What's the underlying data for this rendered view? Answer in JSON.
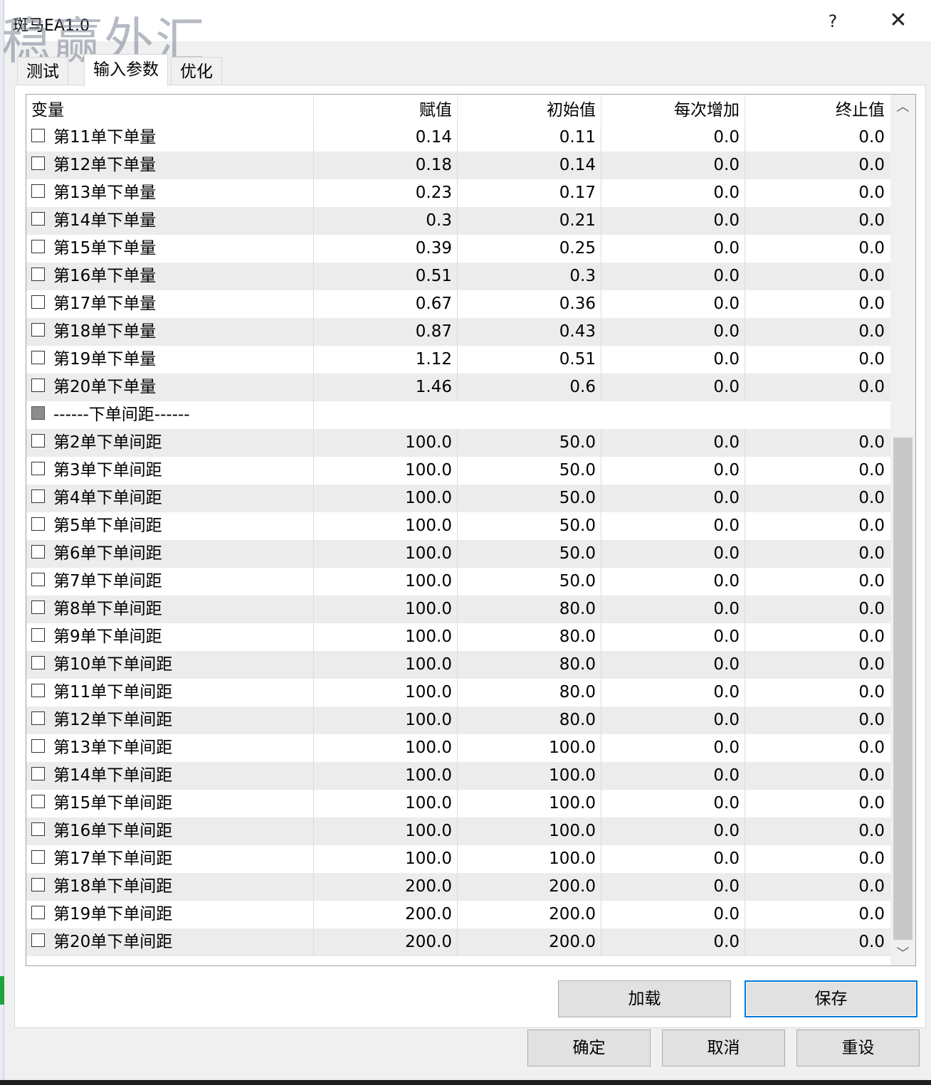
{
  "window": {
    "title": "斑马EA1.0",
    "watermark": "稳赢外汇",
    "help_label": "?",
    "close_label": "✕"
  },
  "tabs": [
    {
      "label": "测试"
    },
    {
      "label": "输入参数"
    },
    {
      "label": "优化"
    }
  ],
  "active_tab": 1,
  "grid": {
    "headers": [
      "变量",
      "赋值",
      "初始值",
      "每次增加",
      "终止值"
    ],
    "rows": [
      {
        "name": "第11单下单量",
        "value": "0.14",
        "start": "0.11",
        "step": "0.0",
        "stop": "0.0"
      },
      {
        "name": "第12单下单量",
        "value": "0.18",
        "start": "0.14",
        "step": "0.0",
        "stop": "0.0"
      },
      {
        "name": "第13单下单量",
        "value": "0.23",
        "start": "0.17",
        "step": "0.0",
        "stop": "0.0"
      },
      {
        "name": "第14单下单量",
        "value": "0.3",
        "start": "0.21",
        "step": "0.0",
        "stop": "0.0"
      },
      {
        "name": "第15单下单量",
        "value": "0.39",
        "start": "0.25",
        "step": "0.0",
        "stop": "0.0"
      },
      {
        "name": "第16单下单量",
        "value": "0.51",
        "start": "0.3",
        "step": "0.0",
        "stop": "0.0"
      },
      {
        "name": "第17单下单量",
        "value": "0.67",
        "start": "0.36",
        "step": "0.0",
        "stop": "0.0"
      },
      {
        "name": "第18单下单量",
        "value": "0.87",
        "start": "0.43",
        "step": "0.0",
        "stop": "0.0"
      },
      {
        "name": "第19单下单量",
        "value": "1.12",
        "start": "0.51",
        "step": "0.0",
        "stop": "0.0"
      },
      {
        "name": "第20单下单量",
        "value": "1.46",
        "start": "0.6",
        "step": "0.0",
        "stop": "0.0"
      },
      {
        "name": "------下单间距------",
        "value": "",
        "start": "",
        "step": "",
        "stop": "",
        "separator": true
      },
      {
        "name": "第2单下单间距",
        "value": "100.0",
        "start": "50.0",
        "step": "0.0",
        "stop": "0.0"
      },
      {
        "name": "第3单下单间距",
        "value": "100.0",
        "start": "50.0",
        "step": "0.0",
        "stop": "0.0"
      },
      {
        "name": "第4单下单间距",
        "value": "100.0",
        "start": "50.0",
        "step": "0.0",
        "stop": "0.0"
      },
      {
        "name": "第5单下单间距",
        "value": "100.0",
        "start": "50.0",
        "step": "0.0",
        "stop": "0.0"
      },
      {
        "name": "第6单下单间距",
        "value": "100.0",
        "start": "50.0",
        "step": "0.0",
        "stop": "0.0"
      },
      {
        "name": "第7单下单间距",
        "value": "100.0",
        "start": "50.0",
        "step": "0.0",
        "stop": "0.0"
      },
      {
        "name": "第8单下单间距",
        "value": "100.0",
        "start": "80.0",
        "step": "0.0",
        "stop": "0.0"
      },
      {
        "name": "第9单下单间距",
        "value": "100.0",
        "start": "80.0",
        "step": "0.0",
        "stop": "0.0"
      },
      {
        "name": "第10单下单间距",
        "value": "100.0",
        "start": "80.0",
        "step": "0.0",
        "stop": "0.0"
      },
      {
        "name": "第11单下单间距",
        "value": "100.0",
        "start": "80.0",
        "step": "0.0",
        "stop": "0.0"
      },
      {
        "name": "第12单下单间距",
        "value": "100.0",
        "start": "80.0",
        "step": "0.0",
        "stop": "0.0"
      },
      {
        "name": "第13单下单间距",
        "value": "100.0",
        "start": "100.0",
        "step": "0.0",
        "stop": "0.0"
      },
      {
        "name": "第14单下单间距",
        "value": "100.0",
        "start": "100.0",
        "step": "0.0",
        "stop": "0.0"
      },
      {
        "name": "第15单下单间距",
        "value": "100.0",
        "start": "100.0",
        "step": "0.0",
        "stop": "0.0"
      },
      {
        "name": "第16单下单间距",
        "value": "100.0",
        "start": "100.0",
        "step": "0.0",
        "stop": "0.0"
      },
      {
        "name": "第17单下单间距",
        "value": "100.0",
        "start": "100.0",
        "step": "0.0",
        "stop": "0.0"
      },
      {
        "name": "第18单下单间距",
        "value": "200.0",
        "start": "200.0",
        "step": "0.0",
        "stop": "0.0"
      },
      {
        "name": "第19单下单间距",
        "value": "200.0",
        "start": "200.0",
        "step": "0.0",
        "stop": "0.0"
      },
      {
        "name": "第20单下单间距",
        "value": "200.0",
        "start": "200.0",
        "step": "0.0",
        "stop": "0.0"
      }
    ]
  },
  "scrollbar": {
    "up_icon": "chevron-up-icon",
    "down_icon": "chevron-down-icon",
    "up_glyph": "︿",
    "down_glyph": "﹀"
  },
  "panel_buttons": {
    "load": "加载",
    "save": "保存"
  },
  "dialog_buttons": {
    "ok": "确定",
    "cancel": "取消",
    "reset": "重设"
  },
  "colors": {
    "alt_row": "#ececec",
    "focus": "#0078d7",
    "button": "#e1e1e1"
  }
}
